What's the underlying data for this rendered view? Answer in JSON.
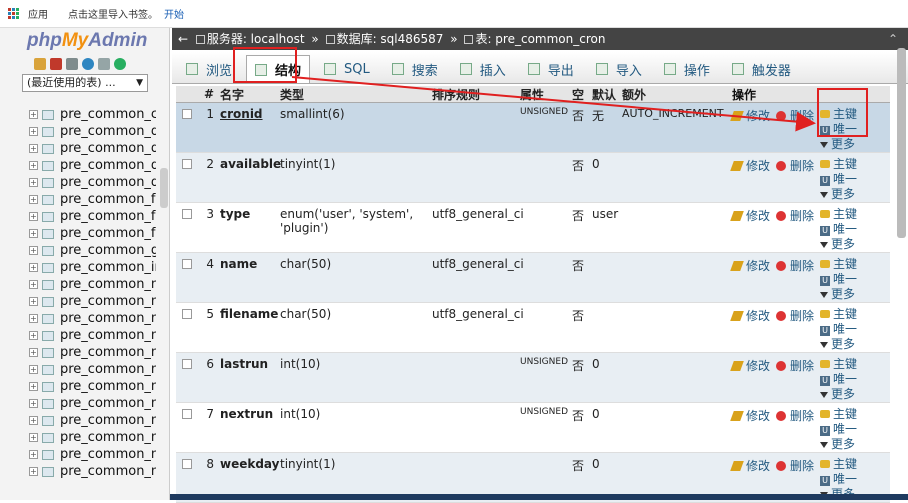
{
  "bookmarks": {
    "apps_label": "应用",
    "import_label": "点击这里导入书签。",
    "start_label": "开始"
  },
  "sidebar": {
    "logo": {
      "php": "php",
      "my": "My",
      "admin": "Admin"
    },
    "recent_label": "(最近使用的表) ...",
    "tables": [
      "pre_common_cron",
      "pre_common_dev",
      "pre_common_dist",
      "pre_common_diy_",
      "pre_common_don",
      "pre_common_faile",
      "pre_common_faile",
      "pre_common_frien",
      "pre_common_grou",
      "pre_common_invi",
      "pre_common_mag",
      "pre_common_mag",
      "pre_common_mai",
      "pre_common_mai",
      "pre_common_mer",
      "pre_common_mer",
      "pre_common_mer",
      "pre_common_mer",
      "pre_common_mer",
      "pre_common_mer",
      "pre_common_mer",
      "pre_common_mer"
    ]
  },
  "breadcrumb": {
    "server": "服务器: localhost",
    "database": "数据库: sql486587",
    "table": "表: pre_common_cron"
  },
  "tabs": [
    {
      "label": "浏览",
      "name": "tab-browse"
    },
    {
      "label": "结构",
      "name": "tab-structure"
    },
    {
      "label": "SQL",
      "name": "tab-sql"
    },
    {
      "label": "搜索",
      "name": "tab-search"
    },
    {
      "label": "插入",
      "name": "tab-insert"
    },
    {
      "label": "导出",
      "name": "tab-export"
    },
    {
      "label": "导入",
      "name": "tab-import"
    },
    {
      "label": "操作",
      "name": "tab-operations"
    },
    {
      "label": "触发器",
      "name": "tab-triggers"
    }
  ],
  "headers": {
    "num": "#",
    "name": "名字",
    "type": "类型",
    "collation": "排序规则",
    "attributes": "属性",
    "null": "空",
    "default": "默认",
    "extra": "额外",
    "action": "操作"
  },
  "actions": {
    "edit": "修改",
    "delete": "删除",
    "primary": "主键",
    "unique": "唯一",
    "more": "更多"
  },
  "rows": [
    {
      "num": "1",
      "name": "cronid",
      "type": "smallint(6)",
      "collation": "",
      "attr": "UNSIGNED",
      "null": "否",
      "default": "无",
      "extra": "AUTO_INCREMENT"
    },
    {
      "num": "2",
      "name": "available",
      "type": "tinyint(1)",
      "collation": "",
      "attr": "",
      "null": "否",
      "default": "0",
      "extra": ""
    },
    {
      "num": "3",
      "name": "type",
      "type": "enum('user', 'system', 'plugin')",
      "collation": "utf8_general_ci",
      "attr": "",
      "null": "否",
      "default": "user",
      "extra": ""
    },
    {
      "num": "4",
      "name": "name",
      "type": "char(50)",
      "collation": "utf8_general_ci",
      "attr": "",
      "null": "否",
      "default": "",
      "extra": ""
    },
    {
      "num": "5",
      "name": "filename",
      "type": "char(50)",
      "collation": "utf8_general_ci",
      "attr": "",
      "null": "否",
      "default": "",
      "extra": ""
    },
    {
      "num": "6",
      "name": "lastrun",
      "type": "int(10)",
      "collation": "",
      "attr": "UNSIGNED",
      "null": "否",
      "default": "0",
      "extra": ""
    },
    {
      "num": "7",
      "name": "nextrun",
      "type": "int(10)",
      "collation": "",
      "attr": "UNSIGNED",
      "null": "否",
      "default": "0",
      "extra": ""
    },
    {
      "num": "8",
      "name": "weekday",
      "type": "tinyint(1)",
      "collation": "",
      "attr": "",
      "null": "否",
      "default": "0",
      "extra": ""
    }
  ],
  "colors": {
    "highlight": "#e02020",
    "link": "#235a81",
    "header_bar": "#444444"
  }
}
